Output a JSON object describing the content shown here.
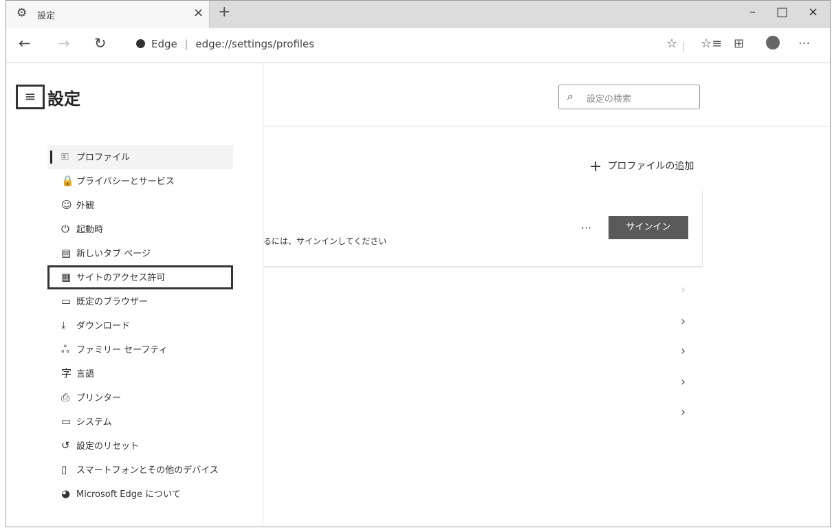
{
  "browser": {
    "tab_title": "設定",
    "tab_close": "×",
    "new_tab": "+",
    "window_controls": {
      "minimize": "–",
      "maximize": "□",
      "close": "×"
    },
    "nav": {
      "back": "←",
      "forward": "→",
      "refresh": "↻"
    },
    "address": {
      "site_label": "Edge",
      "separator": "|",
      "url": "edge://settings/profiles"
    },
    "toolbar_icons": [
      "star-icon",
      "favorites-icon",
      "collections-icon",
      "profile-avatar",
      "more-icon"
    ],
    "more": "···"
  },
  "settings": {
    "menu_glyph": "≡",
    "title": "設定",
    "search_placeholder": "設定の検索",
    "nav_items": [
      {
        "label": "プロファイル",
        "icon": "profile-icon",
        "glyph": "🗉"
      },
      {
        "label": "プライバシーとサービス",
        "icon": "lock-icon",
        "glyph": "🔒"
      },
      {
        "label": "外観",
        "icon": "palette-icon",
        "glyph": "☺"
      },
      {
        "label": "起動時",
        "icon": "power-icon",
        "glyph": "⏻"
      },
      {
        "label": "新しいタブ ページ",
        "icon": "newtab-icon",
        "glyph": "▤"
      },
      {
        "label": "サイトのアクセス許可",
        "icon": "site-permissions-icon",
        "glyph": "▦"
      },
      {
        "label": "既定のブラウザー",
        "icon": "browser-icon",
        "glyph": "▭"
      },
      {
        "label": "ダウンロード",
        "icon": "download-icon",
        "glyph": "⤓"
      },
      {
        "label": "ファミリー セーフティ",
        "icon": "family-icon",
        "glyph": "ஃ"
      },
      {
        "label": "言語",
        "icon": "language-icon",
        "glyph": "字"
      },
      {
        "label": "プリンター",
        "icon": "printer-icon",
        "glyph": "⎙"
      },
      {
        "label": "システム",
        "icon": "system-icon",
        "glyph": "▭"
      },
      {
        "label": "設定のリセット",
        "icon": "reset-icon",
        "glyph": "↺"
      },
      {
        "label": "スマートフォンとその他のデバイス",
        "icon": "phone-icon",
        "glyph": "▯"
      },
      {
        "label": "Microsoft Edge について",
        "icon": "edge-icon",
        "glyph": "◕"
      }
    ]
  },
  "main": {
    "add_profile_plus": "+",
    "add_profile": "プロファイルの追加",
    "signin_message": "るには、サインインしてください",
    "more": "···",
    "signin_button": "サインイン",
    "chevron": "›"
  },
  "colors": {
    "titlebar": "#dcdcdc",
    "signin_button": "#5a5a5a",
    "highlight_box": "#333333"
  }
}
